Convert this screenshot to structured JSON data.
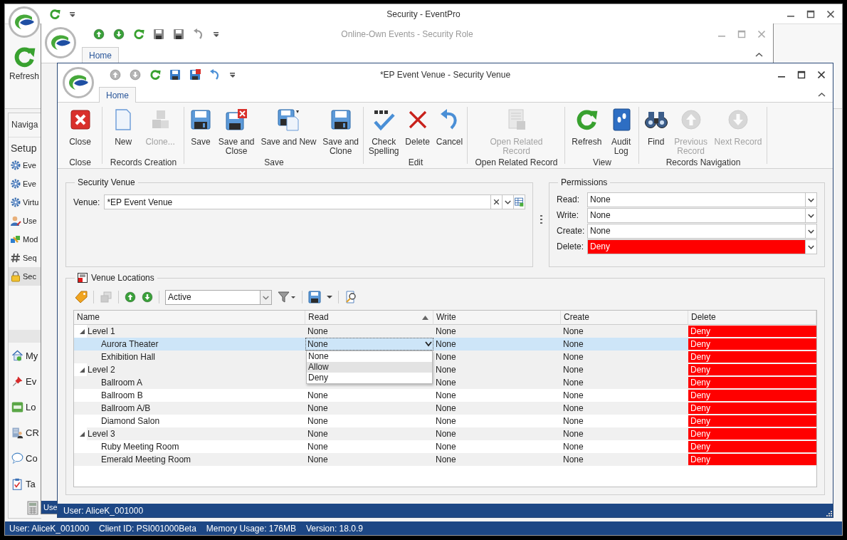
{
  "main_window": {
    "title": "Security - EventPro",
    "refresh_label": "Refresh",
    "navigation_header": "Naviga",
    "setup_header": "Setup",
    "setup_items": [
      {
        "label": "Eve",
        "selected": false
      },
      {
        "label": "Eve",
        "selected": false
      },
      {
        "label": "Virtu",
        "selected": false
      },
      {
        "label": "Use",
        "selected": false
      },
      {
        "label": "Mod",
        "selected": false
      },
      {
        "label": "Seq",
        "selected": false
      },
      {
        "label": "Sec",
        "selected": true
      }
    ],
    "nav_items": [
      {
        "label": "My"
      },
      {
        "label": "Ev"
      },
      {
        "label": "Lo"
      },
      {
        "label": "CR"
      },
      {
        "label": "Co"
      },
      {
        "label": "Ta"
      }
    ],
    "status_bar": [
      "User: AliceK_001000",
      "Client ID: PSI001000Beta",
      "Memory Usage: 176MB",
      "Version: 18.0.9"
    ]
  },
  "role_window": {
    "title": "Online-Own Events - Security Role",
    "tabs": [
      {
        "label": "Home",
        "selected": true
      }
    ],
    "status_bar": "Use"
  },
  "venue_window": {
    "title": "*EP Event Venue - Security Venue",
    "tabs": [
      {
        "label": "Home",
        "selected": true
      }
    ],
    "ribbon_groups": [
      {
        "label": "Close",
        "buttons": [
          {
            "label": "Close",
            "disabled": false
          }
        ]
      },
      {
        "label": "Records Creation",
        "buttons": [
          {
            "label": "New",
            "disabled": false
          },
          {
            "label": "Clone...",
            "disabled": true
          }
        ]
      },
      {
        "label": "Save",
        "buttons": [
          {
            "label": "Save",
            "disabled": false
          },
          {
            "label": "Save and\nClose",
            "disabled": false
          },
          {
            "label": "Save and New",
            "disabled": false
          },
          {
            "label": "Save and\nClone",
            "disabled": false
          }
        ]
      },
      {
        "label": "Edit",
        "buttons": [
          {
            "label": "Check\nSpelling",
            "disabled": false
          },
          {
            "label": "Delete",
            "disabled": false
          },
          {
            "label": "Cancel",
            "disabled": false
          }
        ]
      },
      {
        "label": "Open Related Record",
        "buttons": [
          {
            "label": "Open Related\nRecord",
            "disabled": true
          }
        ]
      },
      {
        "label": "View",
        "buttons": [
          {
            "label": "Refresh",
            "disabled": false
          },
          {
            "label": "Audit\nLog",
            "disabled": false
          }
        ]
      },
      {
        "label": "Records Navigation",
        "buttons": [
          {
            "label": "Find",
            "disabled": false
          },
          {
            "label": "Previous\nRecord",
            "disabled": true
          },
          {
            "label": "Next Record",
            "disabled": true
          }
        ]
      }
    ],
    "security_venue": {
      "title": "Security Venue",
      "venue_label": "Venue:",
      "venue_value": "*EP Event Venue"
    },
    "permissions": {
      "title": "Permissions",
      "fields": [
        {
          "label": "Read:",
          "value": "None",
          "highlighted": false
        },
        {
          "label": "Write:",
          "value": "None",
          "highlighted": false
        },
        {
          "label": "Create:",
          "value": "None",
          "highlighted": false
        },
        {
          "label": "Delete:",
          "value": "Deny",
          "highlighted": true
        }
      ]
    },
    "venue_locations": {
      "title": "Venue Locations",
      "filter_value": "Active",
      "columns": [
        {
          "label": "Name",
          "sorted": false,
          "highlighted": false
        },
        {
          "label": "Read",
          "sorted": true,
          "highlighted": false
        },
        {
          "label": "Write",
          "sorted": false,
          "highlighted": false
        },
        {
          "label": "Create",
          "sorted": false,
          "highlighted": false
        },
        {
          "label": "Delete",
          "sorted": false,
          "highlighted": true
        }
      ],
      "rows": [
        {
          "name": "Level 1",
          "expanded": true,
          "selected": false,
          "read": "None",
          "write": "None",
          "create": "None",
          "delete": "Deny",
          "children": [
            {
              "name": "Aurora Theater",
              "selected": true,
              "read": "None",
              "write": "None",
              "create": "None",
              "delete": "Deny",
              "editor": {
                "options": [
                  {
                    "label": "None",
                    "selected": false
                  },
                  {
                    "label": "Allow",
                    "selected": true
                  },
                  {
                    "label": "Deny",
                    "selected": false
                  }
                ]
              }
            },
            {
              "name": "Exhibition Hall",
              "selected": false,
              "write": "None",
              "create": "None",
              "delete": "Deny"
            }
          ]
        },
        {
          "name": "Level 2",
          "expanded": true,
          "selected": false,
          "write": "None",
          "create": "None",
          "delete": "Deny",
          "children": [
            {
              "name": "Ballroom A",
              "selected": false,
              "write": "None",
              "create": "None",
              "delete": "Deny"
            },
            {
              "name": "Ballroom B",
              "selected": false,
              "read": "None",
              "write": "None",
              "create": "None",
              "delete": "Deny"
            },
            {
              "name": "Ballroom A/B",
              "selected": false,
              "read": "None",
              "write": "None",
              "create": "None",
              "delete": "Deny"
            },
            {
              "name": "Diamond Salon",
              "selected": false,
              "read": "None",
              "write": "None",
              "create": "None",
              "delete": "Deny"
            }
          ]
        },
        {
          "name": "Level 3",
          "expanded": true,
          "selected": false,
          "read": "None",
          "write": "None",
          "create": "None",
          "delete": "Deny",
          "children": [
            {
              "name": "Ruby Meeting Room",
              "selected": false,
              "read": "None",
              "write": "None",
              "create": "None",
              "delete": "Deny"
            },
            {
              "name": "Emerald Meeting Room",
              "selected": false,
              "read": "None",
              "write": "None",
              "create": "None",
              "delete": "Deny"
            }
          ]
        }
      ]
    },
    "status_bar": "User: AliceK_001000"
  }
}
